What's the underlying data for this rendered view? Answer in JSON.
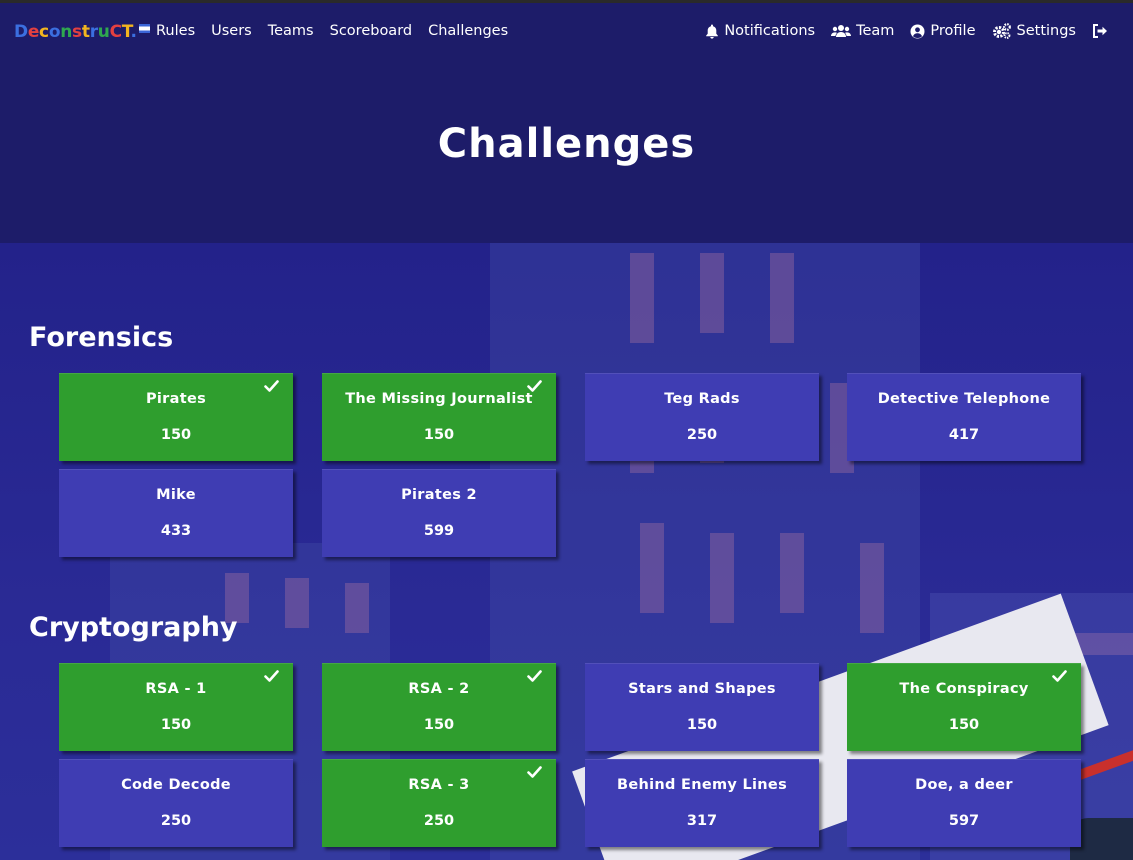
{
  "navbar": {
    "brand": {
      "parts": [
        "D",
        "e",
        "c",
        "o",
        "n",
        "s",
        "t",
        "r",
        "u",
        "C",
        "T",
        "."
      ],
      "colors": [
        "#3b6fe0",
        "#e34040",
        "#f2b51f",
        "#3b6fe0",
        "#2fa84f",
        "#e34040",
        "#f2b51f",
        "#3b6fe0",
        "#2fa84f",
        "#e34040",
        "#f2b51f",
        "#3b6fe0"
      ]
    },
    "links": [
      "Rules",
      "Users",
      "Teams",
      "Scoreboard",
      "Challenges"
    ],
    "right": [
      {
        "label": "Notifications",
        "icon": "bell-icon"
      },
      {
        "label": "Team",
        "icon": "users-icon"
      },
      {
        "label": "Profile",
        "icon": "user-circle-icon"
      },
      {
        "label": "Settings",
        "icon": "gears-icon"
      }
    ],
    "logout_icon": "sign-out-icon"
  },
  "page_title": "Challenges",
  "sections": [
    {
      "title": "Forensics",
      "challenges": [
        {
          "name": "Pirates",
          "points": "150",
          "solved": true
        },
        {
          "name": "The Missing Journalist",
          "points": "150",
          "solved": true
        },
        {
          "name": "Teg Rads",
          "points": "250",
          "solved": false
        },
        {
          "name": "Detective Telephone",
          "points": "417",
          "solved": false
        },
        {
          "name": "Mike",
          "points": "433",
          "solved": false
        },
        {
          "name": "Pirates 2",
          "points": "599",
          "solved": false
        }
      ]
    },
    {
      "title": "Cryptography",
      "challenges": [
        {
          "name": "RSA - 1",
          "points": "150",
          "solved": true
        },
        {
          "name": "RSA - 2",
          "points": "150",
          "solved": true
        },
        {
          "name": "Stars and Shapes",
          "points": "150",
          "solved": false
        },
        {
          "name": "The Conspiracy",
          "points": "150",
          "solved": true
        },
        {
          "name": "Code Decode",
          "points": "250",
          "solved": false
        },
        {
          "name": "RSA - 3",
          "points": "250",
          "solved": true
        },
        {
          "name": "Behind Enemy Lines",
          "points": "317",
          "solved": false
        },
        {
          "name": "Doe, a deer",
          "points": "597",
          "solved": false
        }
      ]
    }
  ],
  "colors": {
    "solved": "#2f9e2e",
    "unsolved": "#3f3db3",
    "header": "#1d1c69"
  }
}
